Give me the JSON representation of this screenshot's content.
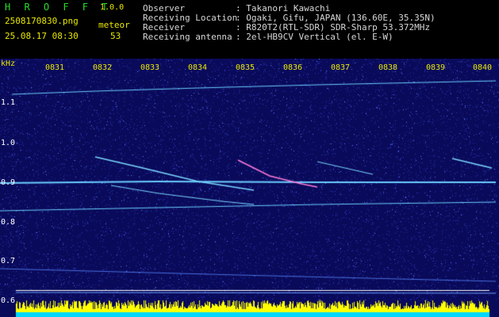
{
  "app": {
    "name": "H R O F F T",
    "version": "1.0.0"
  },
  "file": {
    "name": "2508170830.png",
    "datetime": "25.08.17 08:30"
  },
  "counter": {
    "label": "meteor",
    "value": "53"
  },
  "info": [
    {
      "key": "Observer",
      "value": ": Takanori Kawachi"
    },
    {
      "key": "Receiving Location",
      "value": ": Ogaki, Gifu, JAPAN (136.60E, 35.35N)"
    },
    {
      "key": "Receiver",
      "value": ": R820T2(RTL-SDR) SDR-Sharp 53.372MHz"
    },
    {
      "key": "Receiving antenna",
      "value": ": 2el-HB9CV Vertical (el. E-W)"
    }
  ],
  "axes": {
    "y_unit": "kHz",
    "y_ticks": [
      "1.1",
      "1.0",
      "0.9",
      "0.8",
      "0.7",
      "0.6"
    ],
    "x_ticks": [
      "0831",
      "0832",
      "0833",
      "0834",
      "0835",
      "0836",
      "0837",
      "0838",
      "0839",
      "0840"
    ]
  },
  "colors": {
    "background": "#0a0a5a",
    "noise": "#2c3cc0",
    "trace": "#6ad0ff",
    "header_green": "#2bdc2b",
    "header_yellow": "#e8e800",
    "power_yellow": "#ffff00",
    "power_cyan": "#00d8ff"
  }
}
